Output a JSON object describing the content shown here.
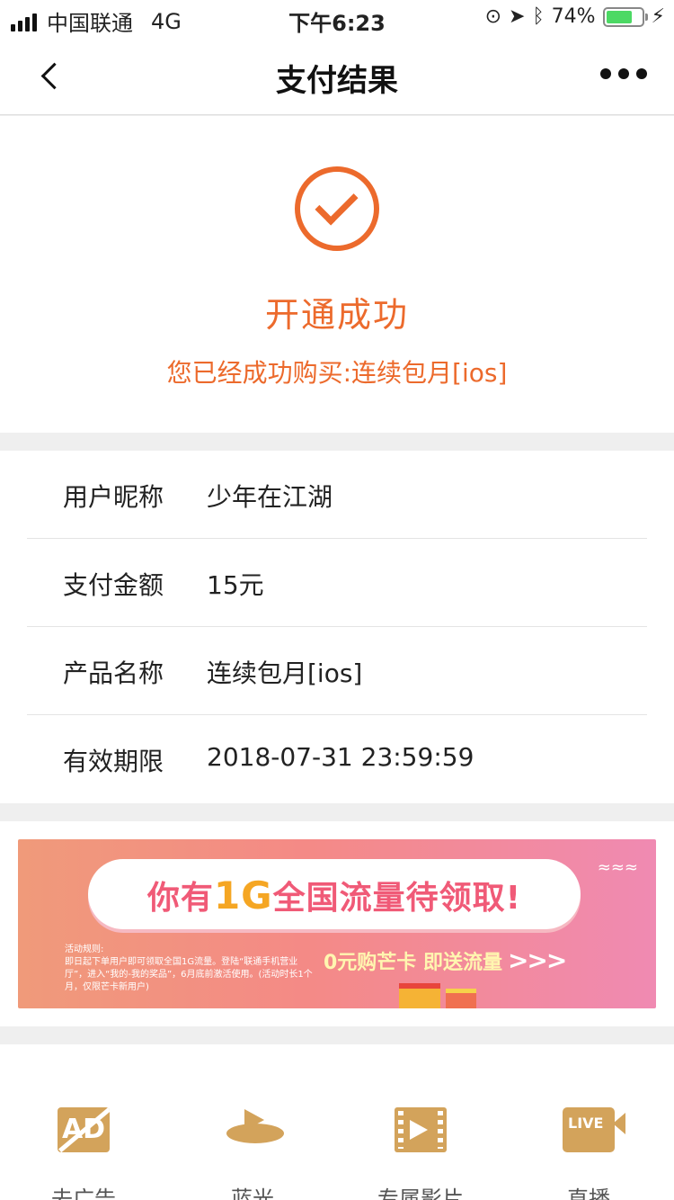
{
  "status_bar": {
    "carrier": "中国联通",
    "network": "4G",
    "time": "下午6:23",
    "battery": "74%",
    "battery_level": 0.74
  },
  "nav": {
    "title": "支付结果"
  },
  "result": {
    "title": "开通成功",
    "message": "您已经成功购买:连续包月[ios]"
  },
  "details": [
    {
      "label": "用户昵称",
      "value": "少年在江湖"
    },
    {
      "label": "支付金额",
      "value": "15元"
    },
    {
      "label": "产品名称",
      "value": "连续包月[ios]"
    },
    {
      "label": "有效期限",
      "value": "2018-07-31 23:59:59"
    }
  ],
  "banner": {
    "headline_pre": "你有",
    "headline_highlight": "1G",
    "headline_post": "全国流量待领取!",
    "rules": "活动规则:\n即日起下单用户即可领取全国1G流量。登陆“联通手机营业厅”，进入“我的-我的奖品”，6月底前激活使用。(活动时长1个月，仅限芒卡新用户)",
    "cta": "0元购芒卡 即送流量",
    "cta_arrows": ">>>"
  },
  "features": [
    {
      "label": "去广告",
      "icon": "ad-block-icon"
    },
    {
      "label": "蓝光",
      "icon": "bluray-icon"
    },
    {
      "label": "专属影片",
      "icon": "film-icon"
    },
    {
      "label": "直播",
      "icon": "live-camera-icon"
    }
  ],
  "colors": {
    "accent": "#ec6a2c",
    "gold": "#d3a35b"
  }
}
